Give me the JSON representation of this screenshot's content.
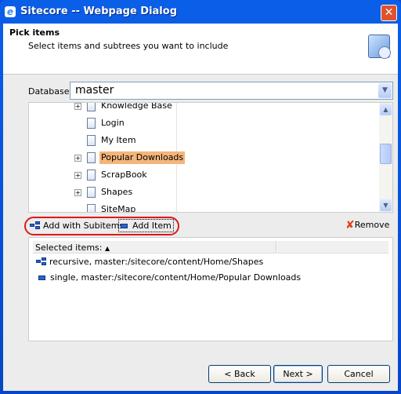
{
  "window": {
    "title": "Sitecore -- Webpage Dialog"
  },
  "header": {
    "title": "Pick items",
    "subtitle": "Select items and subtrees you want to include"
  },
  "database": {
    "label": "Database:",
    "value": "master"
  },
  "tree": {
    "items": [
      {
        "label": "Knowledge Base",
        "expandable": true,
        "selected": false
      },
      {
        "label": "Login",
        "expandable": false,
        "selected": false
      },
      {
        "label": "My Item",
        "expandable": false,
        "selected": false
      },
      {
        "label": "Popular Downloads",
        "expandable": true,
        "selected": true
      },
      {
        "label": "ScrapBook",
        "expandable": true,
        "selected": false
      },
      {
        "label": "Shapes",
        "expandable": true,
        "selected": false
      },
      {
        "label": "SiteMap",
        "expandable": false,
        "selected": false
      }
    ]
  },
  "toolbar": {
    "add_subitems": "Add with Subitems",
    "add_item": "Add Item",
    "remove": "Remove"
  },
  "list": {
    "header": "Selected items:",
    "sort_indicator": "▲",
    "rows": [
      {
        "text": "recursive, master:/sitecore/content/Home/Shapes",
        "icon": "subitems-icon"
      },
      {
        "text": "single, master:/sitecore/content/Home/Popular Downloads",
        "icon": "item-icon"
      }
    ]
  },
  "buttons": {
    "back": "< Back",
    "next": "Next >",
    "cancel": "Cancel"
  },
  "colors": {
    "titlebar": "#0a5fe8",
    "selection": "#f4b57a",
    "highlight_oval": "#e01818"
  }
}
